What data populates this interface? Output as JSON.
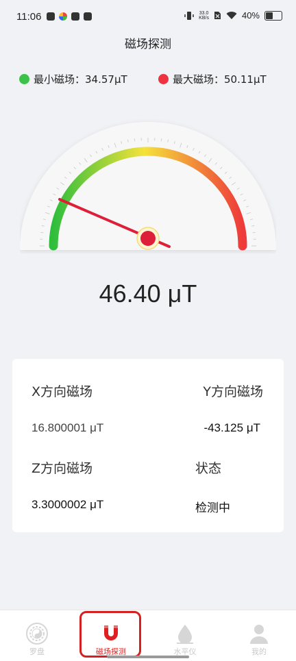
{
  "status_bar": {
    "time": "11:06",
    "net_speed_top": "33.0",
    "net_speed_bottom": "KB/s",
    "battery": "40%"
  },
  "header": {
    "title": "磁场探测"
  },
  "legend": {
    "min_label": "最小磁场：34.57μT",
    "max_label": "最大磁场：50.11μT",
    "min_color": "#3cc24a",
    "max_color": "#ee3340"
  },
  "gauge": {
    "value": 46.4,
    "min": 0,
    "max": 100,
    "needle_color": "#dd1f3a",
    "colors": [
      "#2fbe3c",
      "#f5e23a",
      "#ee3a3a"
    ]
  },
  "reading": {
    "text": "46.40 μT"
  },
  "card": {
    "x_label": "X方向磁场",
    "y_label": "Y方向磁场",
    "x_value": "16.800001 μT",
    "y_value": "-43.125 μT",
    "z_label": "Z方向磁场",
    "status_label": "状态",
    "z_value": "3.3000002 μT",
    "status_value": "检测中"
  },
  "tabs": [
    {
      "label": "罗盘",
      "icon": "compass-bagua-icon",
      "active": false
    },
    {
      "label": "磁场探测",
      "icon": "magnet-icon",
      "active": true
    },
    {
      "label": "水平仪",
      "icon": "water-drop-icon",
      "active": false
    },
    {
      "label": "我的",
      "icon": "user-icon",
      "active": false
    }
  ]
}
